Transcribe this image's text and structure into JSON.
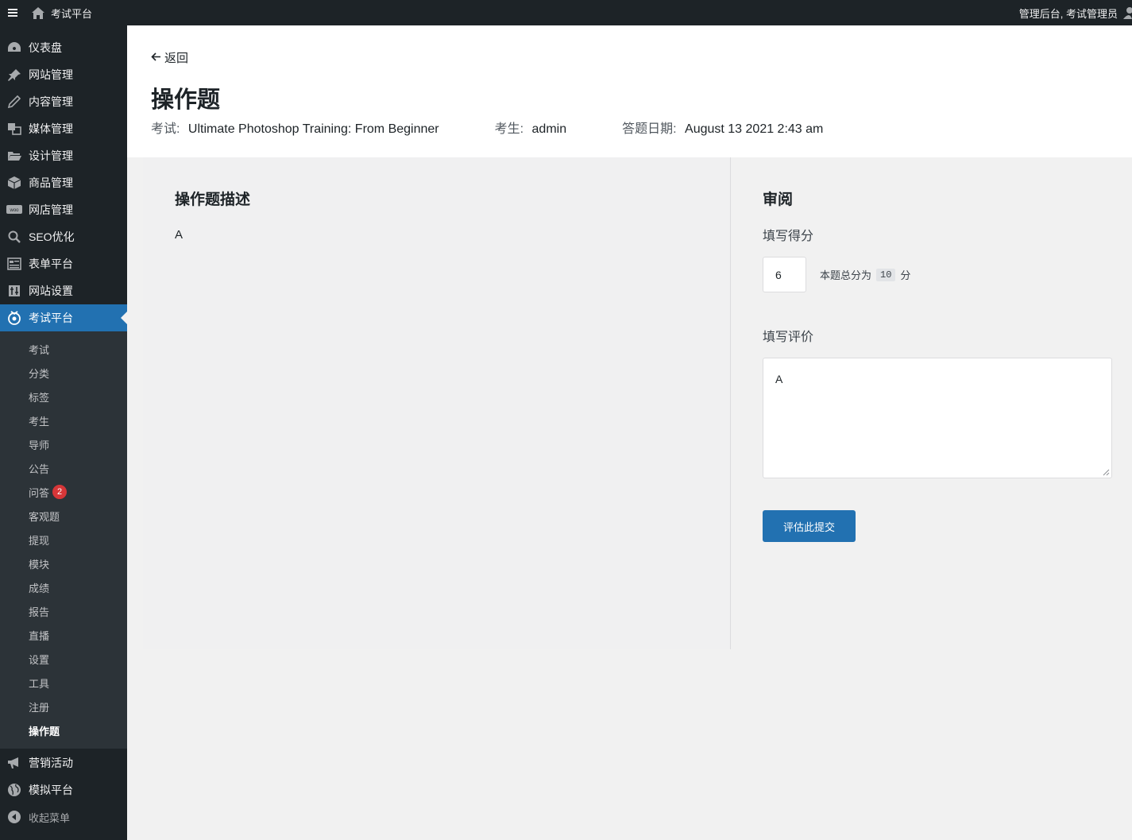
{
  "adminbar": {
    "site_name": "考试平台",
    "greeting": "管理后台, 考试管理员"
  },
  "sidebar": {
    "items": [
      {
        "label": "仪表盘",
        "icon": "dashboard-icon"
      },
      {
        "label": "网站管理",
        "icon": "pin-icon"
      },
      {
        "label": "内容管理",
        "icon": "pencil-icon"
      },
      {
        "label": "媒体管理",
        "icon": "media-icon"
      },
      {
        "label": "设计管理",
        "icon": "folder-icon"
      },
      {
        "label": "商品管理",
        "icon": "box-icon"
      },
      {
        "label": "网店管理",
        "icon": "woo-icon"
      },
      {
        "label": "SEO优化",
        "icon": "search-icon"
      },
      {
        "label": "表单平台",
        "icon": "form-icon"
      },
      {
        "label": "网站设置",
        "icon": "settings-icon"
      },
      {
        "label": "考试平台",
        "icon": "exam-icon"
      }
    ],
    "submenu": [
      "考试",
      "分类",
      "标签",
      "考生",
      "导师",
      "公告",
      "问答",
      "客观题",
      "提现",
      "模块",
      "成绩",
      "报告",
      "直播",
      "设置",
      "工具",
      "注册",
      "操作题"
    ],
    "qa_badge": "2",
    "after_items": [
      {
        "label": "营销活动",
        "icon": "megaphone-icon"
      },
      {
        "label": "模拟平台",
        "icon": "globe-icon"
      }
    ],
    "collapse_label": "收起菜单"
  },
  "header": {
    "back_label": "返回",
    "title": "操作题",
    "exam_label": "考试:",
    "exam_value": "Ultimate Photoshop Training: From Beginner",
    "student_label": "考生:",
    "student_value": "admin",
    "date_label": "答题日期:",
    "date_value": "August 13 2021 2:43 am"
  },
  "left_panel": {
    "title": "操作题描述",
    "description": "A"
  },
  "right_panel": {
    "title": "审阅",
    "score_label": "填写得分",
    "score_value": "6",
    "score_hint_prefix": "本题总分为",
    "score_total": "10",
    "score_hint_suffix": "分",
    "review_label": "填写评价",
    "review_value": "A",
    "submit_label": "评估此提交"
  },
  "colors": {
    "adminbar": "#1d2327",
    "accent": "#2271b1",
    "submenu_bg": "#2c3338",
    "badge": "#d63638"
  }
}
